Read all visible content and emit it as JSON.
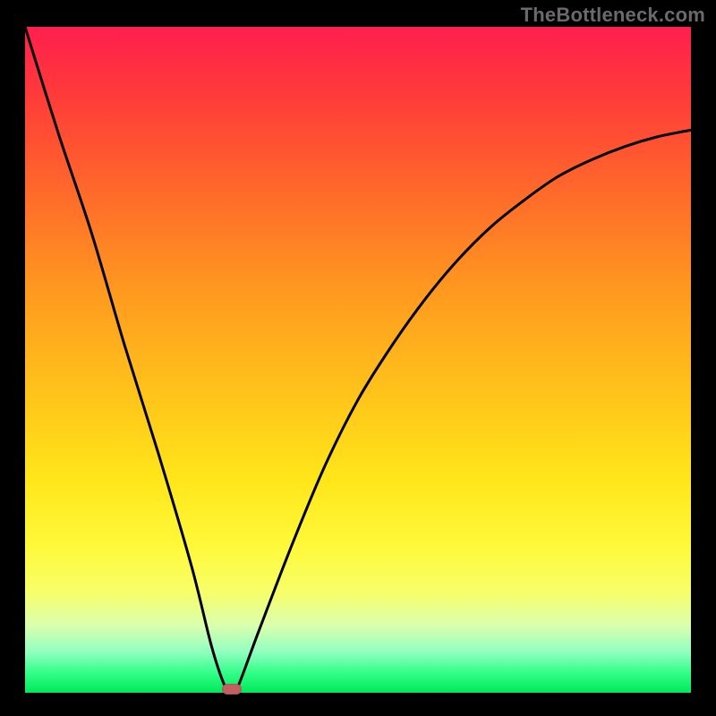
{
  "watermark_text": "TheBottleneck.com",
  "chart_data": {
    "type": "line",
    "title": "",
    "xlabel": "",
    "ylabel": "",
    "xlim": [
      0,
      100
    ],
    "ylim": [
      0,
      100
    ],
    "grid": false,
    "series": [
      {
        "name": "bottleneck-curve",
        "x": [
          0,
          5,
          10,
          15,
          20,
          25,
          28,
          30,
          31,
          32,
          35,
          40,
          45,
          50,
          55,
          60,
          65,
          70,
          75,
          80,
          85,
          90,
          95,
          100
        ],
        "values": [
          100,
          84,
          69,
          52,
          36,
          19,
          7,
          1,
          0,
          1,
          9,
          22,
          34,
          44,
          52,
          59,
          65,
          70,
          74,
          77.5,
          80,
          82,
          83.5,
          84.5
        ]
      }
    ],
    "annotations": [
      {
        "name": "min-marker",
        "x": 31,
        "y": 0,
        "shape": "ellipse",
        "color": "#c06060"
      }
    ],
    "background_gradient": {
      "top": "#ff1f4e",
      "mid": "#ffe61a",
      "bottom": "#00e85a"
    }
  }
}
